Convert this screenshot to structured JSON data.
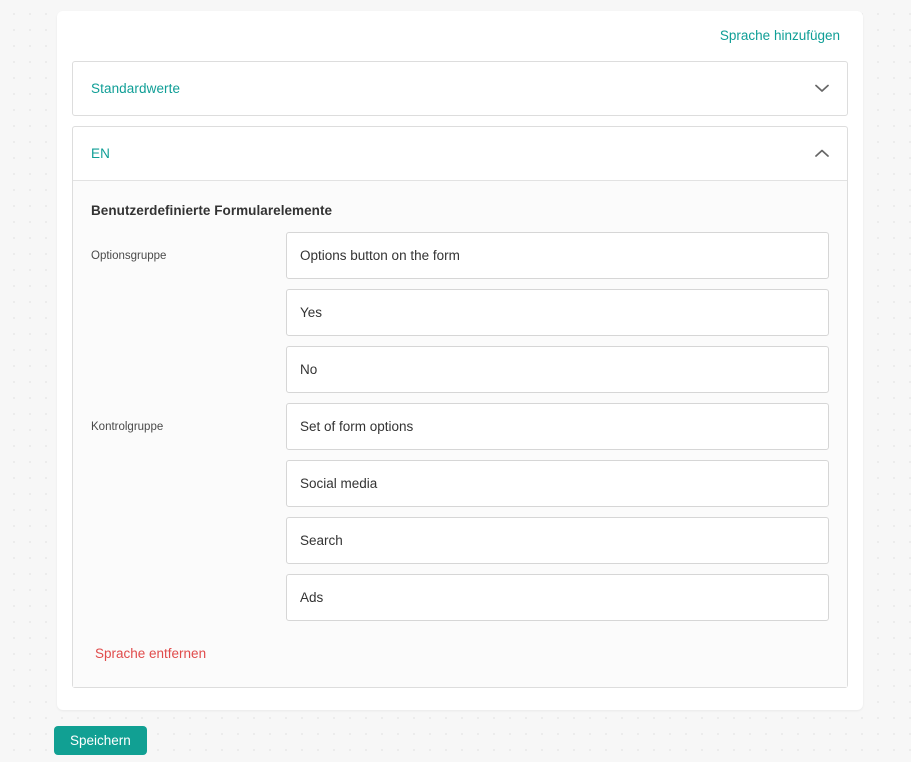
{
  "toolbar": {
    "add_language_label": "Sprache hinzufügen"
  },
  "panels": [
    {
      "title": "Standardwerte",
      "expanded": false,
      "chevron_icon": "chevron-down-icon"
    },
    {
      "title": "EN",
      "expanded": true,
      "chevron_icon": "chevron-up-icon",
      "section_title": "Benutzerdefinierte Formularelemente",
      "fields": [
        {
          "label": "Optionsgruppe",
          "inputs": [
            {
              "value": "Options button on the form",
              "placeholder": ""
            },
            {
              "value": "Yes",
              "placeholder": ""
            },
            {
              "value": "No",
              "placeholder": ""
            }
          ]
        },
        {
          "label": "Kontrolgruppe",
          "inputs": [
            {
              "value": "Set of form options",
              "placeholder": ""
            },
            {
              "value": "Social media",
              "placeholder": ""
            },
            {
              "value": "Search",
              "placeholder": ""
            },
            {
              "value": "Ads",
              "placeholder": ""
            }
          ]
        }
      ],
      "remove_language_label": "Sprache entfernen"
    }
  ],
  "footer": {
    "save_label": "Speichern"
  },
  "colors": {
    "accent_teal": "#0f9e96",
    "save_button": "#11a093",
    "danger_red": "#e04b4b",
    "panel_border": "#dddddd",
    "input_border": "#d6d6d6",
    "panel_body_bg": "#fbfbfb",
    "page_bg": "#f7f7f7",
    "card_bg": "#ffffff"
  }
}
